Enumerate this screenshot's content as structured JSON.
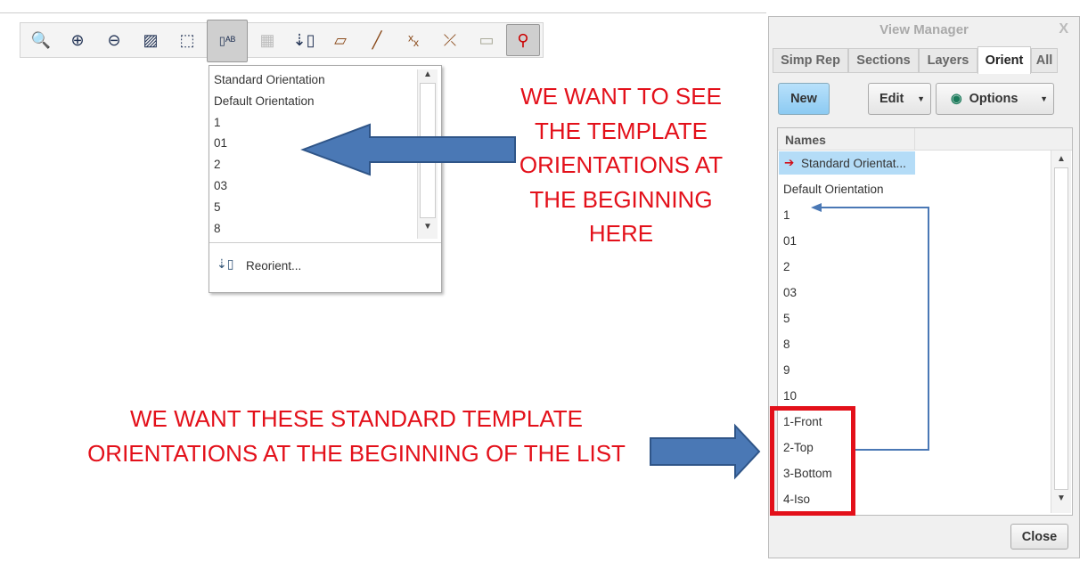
{
  "toolbar": {
    "icons": [
      "refit-icon",
      "zoom-in-icon",
      "zoom-out-icon",
      "repaint-icon",
      "display-style-icon",
      "saved-orientations-icon",
      "view-manager-icon",
      "reorient-icon",
      "plane-display-icon",
      "axis-display-icon",
      "point-display-icon",
      "csys-display-icon",
      "annotation-display-icon",
      "spin-center-icon"
    ]
  },
  "dropdown": {
    "items": [
      "Standard Orientation",
      "Default Orientation",
      "1",
      "01",
      "2",
      "03",
      "5",
      "8"
    ],
    "reorient_label": "Reorient..."
  },
  "annotations": {
    "top_note": [
      "WE WANT TO SEE",
      "THE TEMPLATE",
      "ORIENTATIONS AT",
      "THE BEGINNING",
      "HERE"
    ],
    "bottom_note": [
      "WE WANT THESE STANDARD TEMPLATE",
      "ORIENTATIONS AT THE BEGINNING OF THE LIST"
    ],
    "arrow_color": "#4a78b5",
    "text_color": "#e3101a"
  },
  "view_manager": {
    "title": "View Manager",
    "close_x": "X",
    "tabs": [
      "Simp Rep",
      "Sections",
      "Layers",
      "Orient",
      "All"
    ],
    "active_tab": "Orient",
    "new_label": "New",
    "edit_label": "Edit",
    "options_label": "Options",
    "column_header": "Names",
    "items": [
      "Standard Orientat...",
      "Default Orientation",
      "1",
      "01",
      "2",
      "03",
      "5",
      "8",
      "9",
      "10",
      "1-Front",
      "2-Top",
      "3-Bottom",
      "4-Iso"
    ],
    "close_label": "Close"
  }
}
